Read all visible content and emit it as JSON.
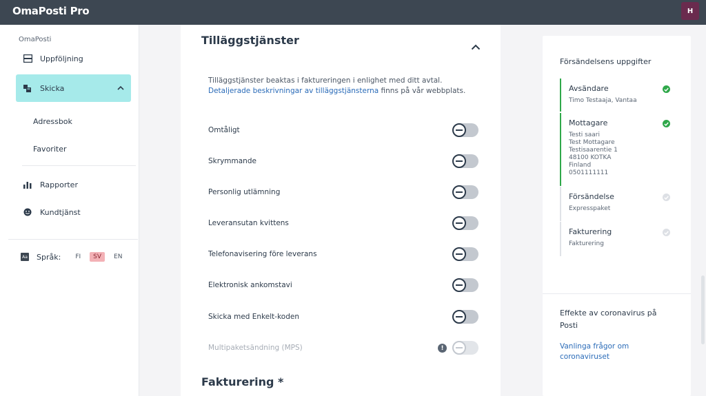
{
  "app": {
    "brand": "OmaPosti Pro",
    "user_initial": "H"
  },
  "sidebar": {
    "section_label": "OmaPosti",
    "items": [
      {
        "label": "Uppföljning",
        "icon": "tray-icon"
      },
      {
        "label": "Skicka",
        "icon": "packages-icon",
        "active": true
      },
      {
        "label": "Adressbok"
      },
      {
        "label": "Favoriter"
      },
      {
        "label": "Rapporter",
        "icon": "bar-chart-icon"
      },
      {
        "label": "Kundtjänst",
        "icon": "smiley-icon"
      }
    ],
    "language": {
      "label": "Språk:",
      "options": [
        "FI",
        "SV",
        "EN"
      ],
      "selected": "SV"
    }
  },
  "main": {
    "section_title": "Tilläggstjänster",
    "desc_text": "Tilläggstjänster beaktas i faktureringen i enlighet med ditt avtal.",
    "desc_link": "Detaljerade beskrivningar av tilläggstjänsterna",
    "desc_suffix": " finns på vår webbplats.",
    "options": [
      {
        "label": "Omtåligt",
        "enabled": false
      },
      {
        "label": "Skrymmande",
        "enabled": false
      },
      {
        "label": "Personlig utlämning",
        "enabled": false
      },
      {
        "label": "Leveransutan kvittens",
        "enabled": false
      },
      {
        "label": "Telefonavisering före leverans",
        "enabled": false
      },
      {
        "label": "Elektronisk ankomstavi",
        "enabled": false
      },
      {
        "label": "Skicka med Enkelt-koden",
        "enabled": false
      },
      {
        "label": "Multipaketsändning (MPS)",
        "enabled": false,
        "disabled": true,
        "info": "!"
      }
    ],
    "next_section_title": "Fakturering *"
  },
  "summary": {
    "title": "Försändelsens uppgifter",
    "steps": [
      {
        "name": "Avsändare",
        "detail": "Timo Testaaja, Vantaa",
        "done": true
      },
      {
        "name": "Mottagare",
        "detail": "Testi saari\nTest Mottagare\nTestisaarentie 1\n48100 KOTKA\nFinland\n0501111111",
        "done": true
      },
      {
        "name": "Försändelse",
        "detail": "Expresspaket",
        "done": false
      },
      {
        "name": "Fakturering",
        "detail": "Fakturering",
        "done": false
      }
    ],
    "covid_title": "Effekte av coronavirus på Posti",
    "covid_link": "Vanlinga frågor om coronaviruset"
  },
  "colors": {
    "accent": "#a6eaea",
    "topbar": "#3d4752",
    "success": "#2fa84a",
    "link": "#2a6bb8",
    "lang_selected": "#f3b1b6"
  }
}
